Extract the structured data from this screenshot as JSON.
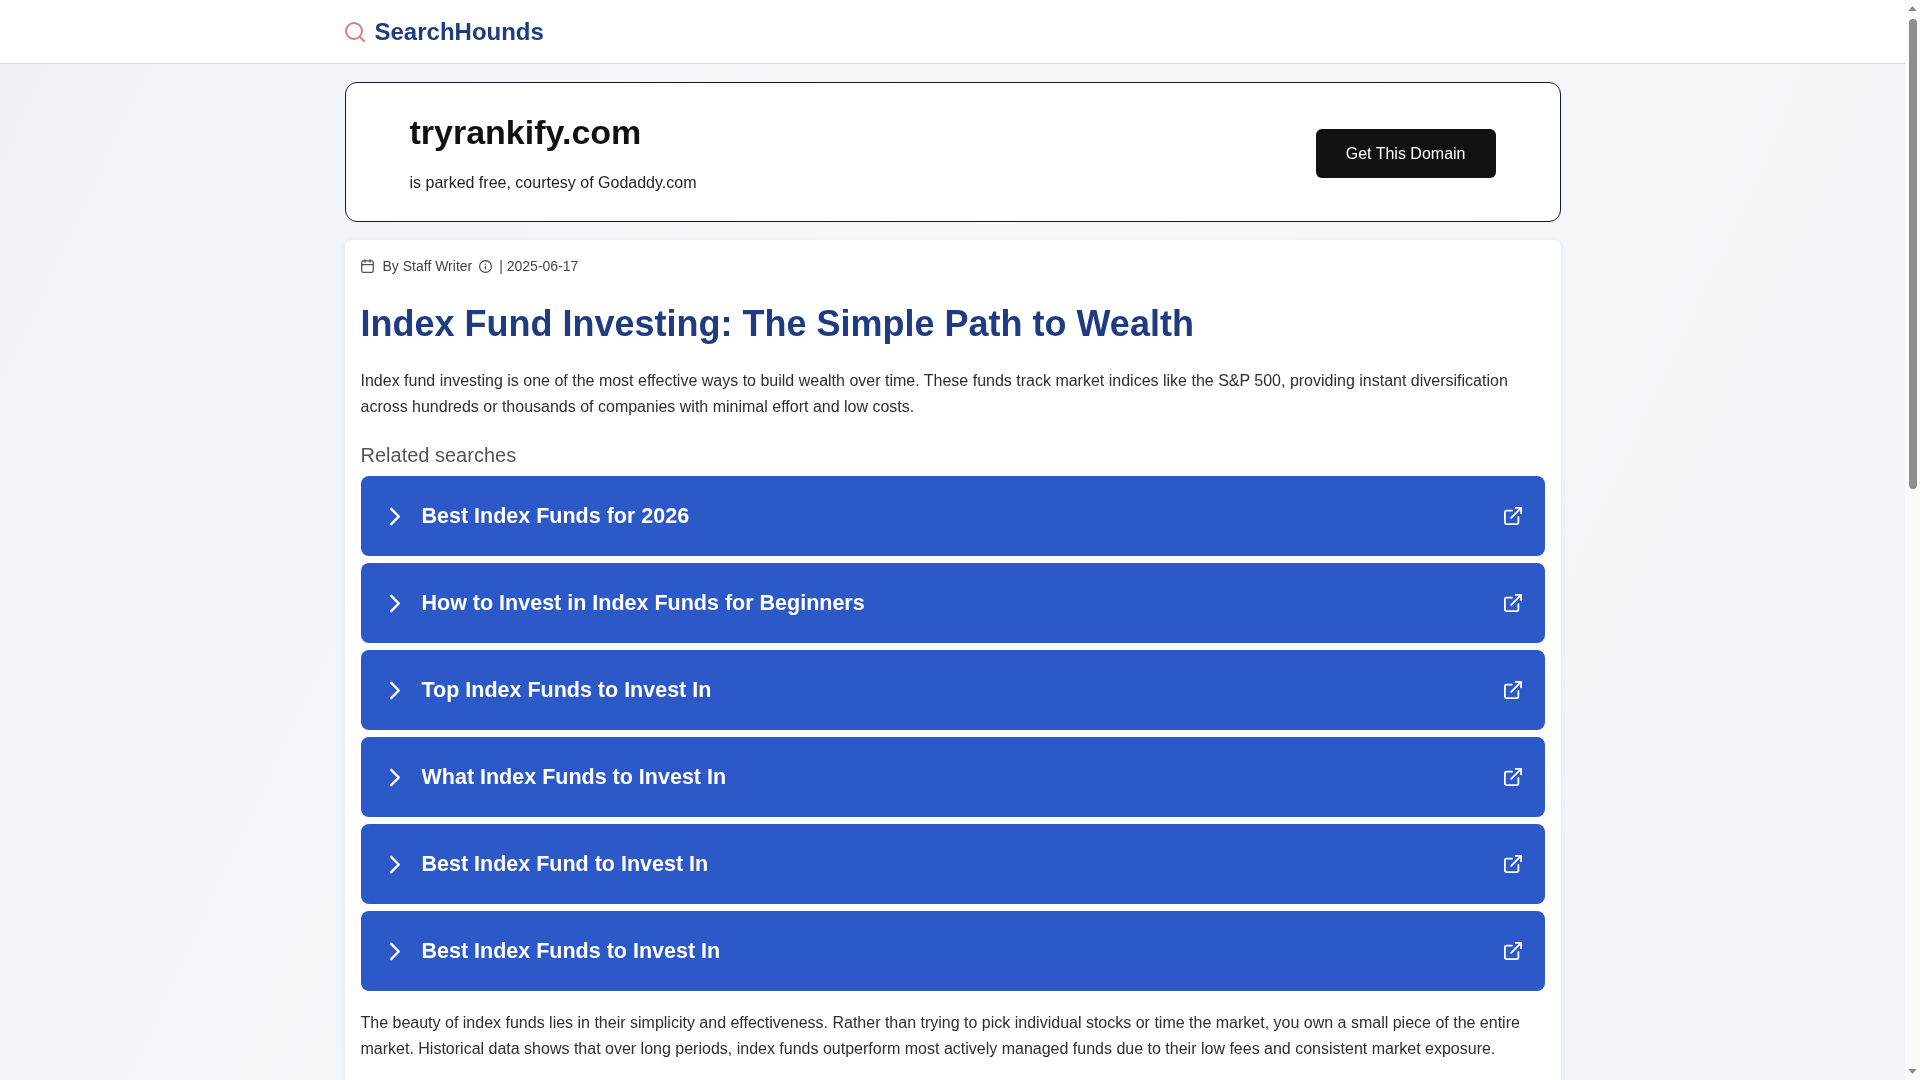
{
  "header": {
    "logo_text": "SearchHounds"
  },
  "domain_banner": {
    "domain": "tryrankify.com",
    "subtitle": "is parked free, courtesy of Godaddy.com",
    "button": "Get This Domain"
  },
  "article": {
    "byline": {
      "author": "By Staff Writer",
      "date": "| 2025-06-17"
    },
    "title": "Index Fund Investing: The Simple Path to Wealth",
    "intro": "Index fund investing is one of the most effective ways to build wealth over time. These funds track market indices like the S&P 500, providing instant diversification across hundreds or thousands of companies with minimal effort and low costs.",
    "related_searches": {
      "heading": "Related searches",
      "items": [
        "Best Index Funds for 2026",
        "How to Invest in Index Funds for Beginners",
        "Top Index Funds to Invest In",
        "What Index Funds to Invest In",
        "Best Index Fund to Invest In",
        "Best Index Funds to Invest In"
      ]
    },
    "body": "The beauty of index funds lies in their simplicity and effectiveness. Rather than trying to pick individual stocks or time the market, you own a small piece of the entire market. Historical data shows that over long periods, index funds outperform most actively managed funds due to their low fees and consistent market exposure."
  }
}
